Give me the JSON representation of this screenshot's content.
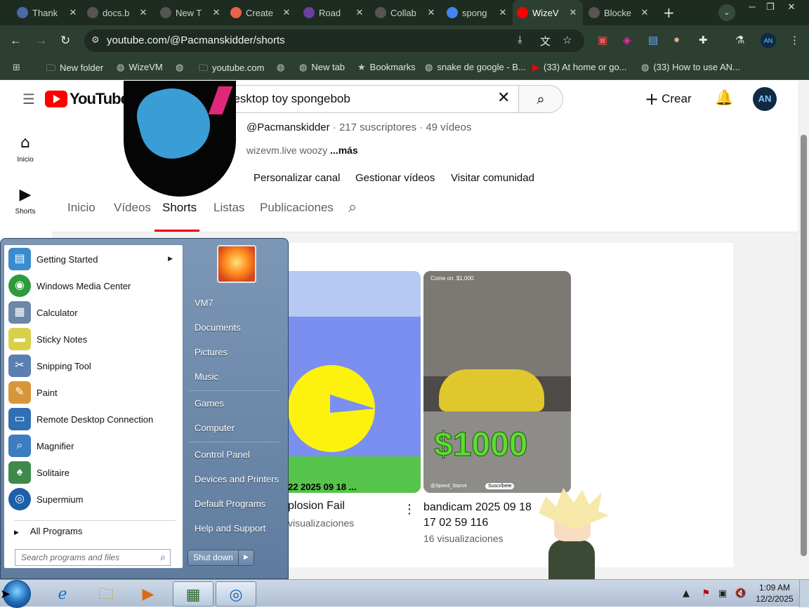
{
  "browser": {
    "tabs": [
      {
        "label": "Thank",
        "icon": "x-twitter-icon",
        "color": "#4a6aa8",
        "active": false
      },
      {
        "label": "docs.b",
        "icon": "globe-icon",
        "color": "#555",
        "active": false
      },
      {
        "label": "New T",
        "icon": "chrome-icon",
        "color": "#555",
        "active": false
      },
      {
        "label": "Create",
        "icon": "scratch-icon",
        "color": "#e8634a",
        "active": false
      },
      {
        "label": "Road",
        "icon": "purple-circle-icon",
        "color": "#6b3fa0",
        "active": false
      },
      {
        "label": "Collab",
        "icon": "globe-icon",
        "color": "#555",
        "active": false
      },
      {
        "label": "spong",
        "icon": "google-icon",
        "color": "#4285f4",
        "active": false
      },
      {
        "label": "WizeV",
        "icon": "youtube-icon",
        "color": "#f00",
        "active": true
      },
      {
        "label": "Blocke",
        "icon": "globe-icon",
        "color": "#555",
        "active": false
      }
    ],
    "url": "youtube.com/@Pacmanskidder/shorts",
    "bookmarks": [
      "New folder",
      "WizeVM",
      "",
      "youtube.com",
      "",
      "New tab",
      "Bookmarks",
      "snake de google - B...",
      "(33) At home or go...",
      "(33) How to use AN..."
    ]
  },
  "youtube": {
    "search_value": "desktop toy spongebob",
    "create_label": "Crear",
    "avatar_text": "AN",
    "guide": [
      {
        "label": "Inicio",
        "icon": "home-icon"
      },
      {
        "label": "Shorts",
        "icon": "shorts-icon"
      }
    ],
    "channel": {
      "handle": "@Pacmanskidder",
      "subs": " · 217 suscriptores · 49 vídeos",
      "desc": "wizevm.live woozy",
      "more": " ...más",
      "buttons": [
        "Personalizar canal",
        "Gestionar vídeos",
        "Visitar comunidad"
      ],
      "tabs": [
        "Inicio",
        "Vídeos",
        "Shorts",
        "Listas",
        "Publicaciones"
      ],
      "active_tab": "Shorts"
    },
    "shorts": [
      {
        "title": "plosion Fail",
        "views": "visualizaciones",
        "overlay": "22 2025 09 18 ..."
      },
      {
        "title": "bandicam 2025 09 18 17 02 59 116",
        "views": "16 visualizaciones",
        "overlay_money": "$1000",
        "overlay_tag": "Come on. $1,000.",
        "overlay_sub": "Suscríbete",
        "overlay_chan": "@Speed_Stars4"
      }
    ]
  },
  "start_menu": {
    "programs": [
      {
        "label": "Getting Started",
        "icon": "getting-started-icon",
        "color": "#3a8ccf",
        "submenu": true
      },
      {
        "label": "Windows Media Center",
        "icon": "media-center-icon",
        "color": "#2e9a3c"
      },
      {
        "label": "Calculator",
        "icon": "calculator-icon",
        "color": "#6b88a8"
      },
      {
        "label": "Sticky Notes",
        "icon": "sticky-notes-icon",
        "color": "#d9d04a"
      },
      {
        "label": "Snipping Tool",
        "icon": "snipping-tool-icon",
        "color": "#5a7fb0"
      },
      {
        "label": "Paint",
        "icon": "paint-icon",
        "color": "#d8963a"
      },
      {
        "label": "Remote Desktop Connection",
        "icon": "remote-desktop-icon",
        "color": "#2f6fb3"
      },
      {
        "label": "Magnifier",
        "icon": "magnifier-icon",
        "color": "#3c7dc0"
      },
      {
        "label": "Solitaire",
        "icon": "solitaire-icon",
        "color": "#3d8a4a"
      },
      {
        "label": "Supermium",
        "icon": "supermium-icon",
        "color": "#1d5fa8"
      }
    ],
    "all_programs": "All Programs",
    "search_placeholder": "Search programs and files",
    "right_links": [
      "VM7",
      "Documents",
      "Pictures",
      "Music",
      "Games",
      "Computer",
      "Control Panel",
      "Devices and Printers",
      "Default Programs",
      "Help and Support"
    ],
    "shutdown": "Shut down"
  },
  "taskbar": {
    "time": "1:09 AM",
    "date": "12/2/2025"
  }
}
